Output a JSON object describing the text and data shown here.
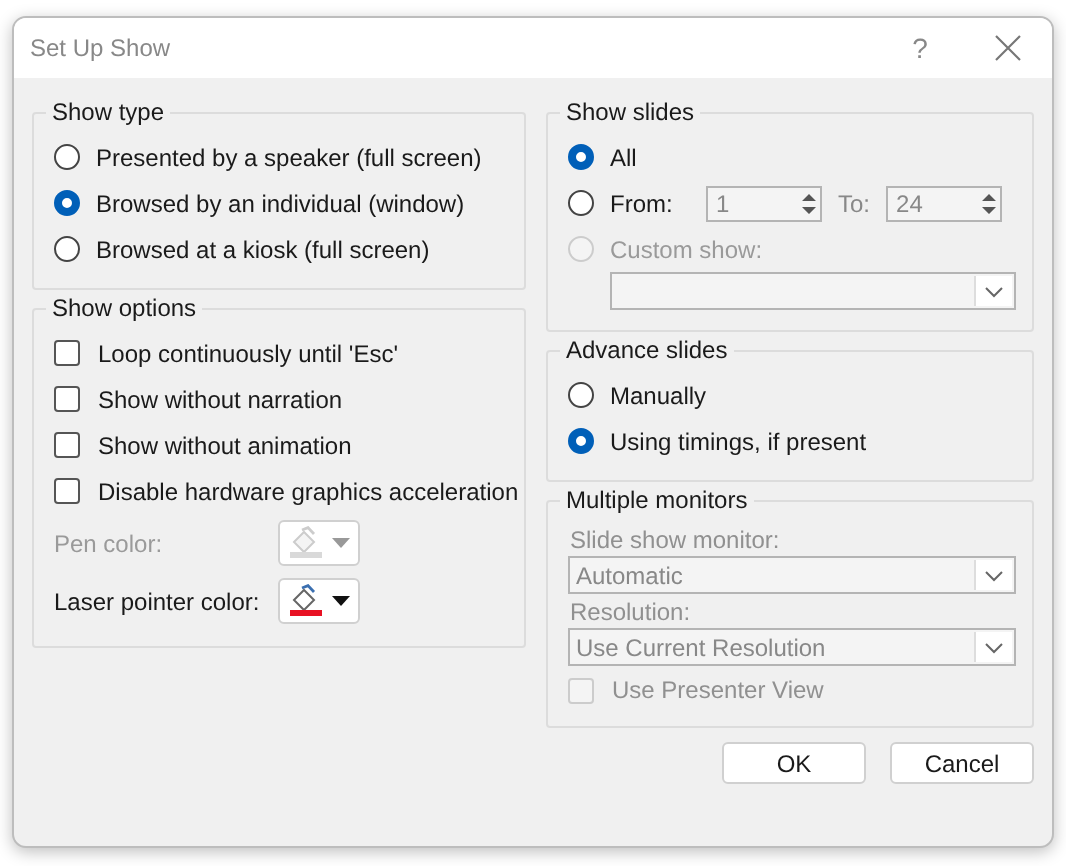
{
  "window": {
    "title": "Set Up Show",
    "help": "?"
  },
  "show_type": {
    "title": "Show type",
    "options": [
      {
        "label": "Presented by a speaker (full screen)",
        "selected": false
      },
      {
        "label": "Browsed by an individual (window)",
        "selected": true
      },
      {
        "label": "Browsed at a kiosk (full screen)",
        "selected": false
      }
    ]
  },
  "show_options": {
    "title": "Show options",
    "checkboxes": [
      {
        "label": "Loop continuously until 'Esc'",
        "checked": false
      },
      {
        "label": "Show without narration",
        "checked": false
      },
      {
        "label": "Show without animation",
        "checked": false
      },
      {
        "label": "Disable hardware graphics acceleration",
        "checked": false
      }
    ],
    "colors": [
      {
        "label": "Pen color:",
        "disabled": true,
        "color": "#d9d9d9"
      },
      {
        "label": "Laser pointer color:",
        "disabled": false,
        "color": "#e81123"
      }
    ]
  },
  "show_slides": {
    "title": "Show slides",
    "options": [
      {
        "kind": "all",
        "label": "All",
        "selected": true,
        "disabled": false
      },
      {
        "kind": "range",
        "label": "From:",
        "selected": false,
        "disabled": false,
        "from": "1",
        "to_label": "To:",
        "to": "24"
      },
      {
        "kind": "custom",
        "label": "Custom show:",
        "selected": false,
        "disabled": true
      }
    ]
  },
  "advance_slides": {
    "title": "Advance slides",
    "options": [
      {
        "label": "Manually",
        "selected": false
      },
      {
        "label": "Using timings, if present",
        "selected": true
      }
    ]
  },
  "multiple_monitors": {
    "title": "Multiple monitors",
    "disabled": true,
    "monitor_label": "Slide show monitor:",
    "monitor": "Automatic",
    "resolution_label": "Resolution:",
    "resolution": "Use Current Resolution",
    "presenter_view": {
      "label": "Use Presenter View",
      "checked": false
    }
  },
  "buttons": [
    "OK",
    "Cancel"
  ]
}
